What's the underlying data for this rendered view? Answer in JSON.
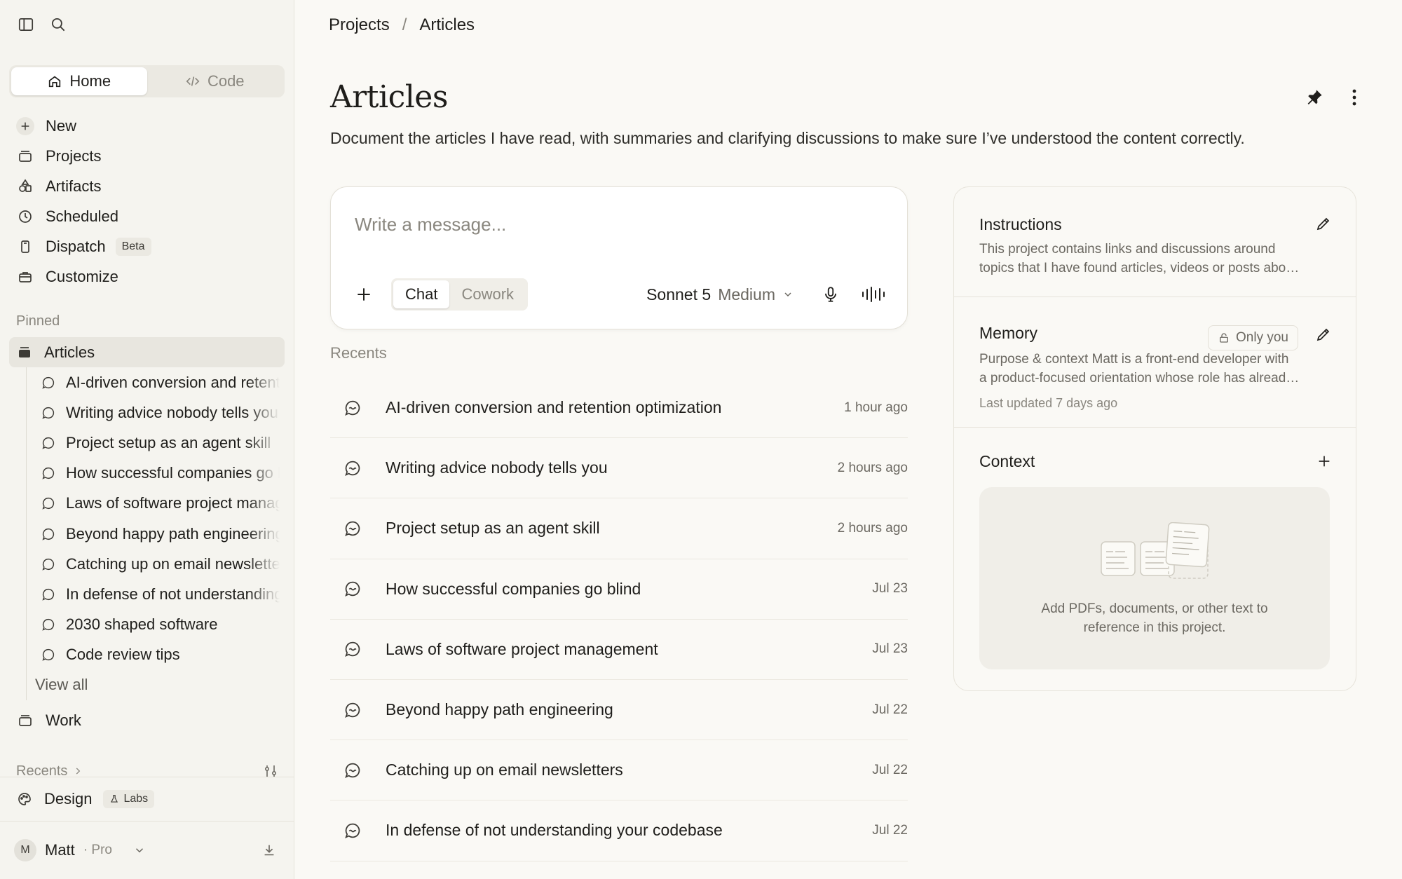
{
  "sidebar": {
    "mode_tabs": [
      {
        "label": "Home",
        "active": true
      },
      {
        "label": "Code",
        "active": false
      }
    ],
    "nav": [
      {
        "label": "New",
        "icon": "plus-icon"
      },
      {
        "label": "Projects",
        "icon": "folder-icon"
      },
      {
        "label": "Artifacts",
        "icon": "shapes-icon"
      },
      {
        "label": "Scheduled",
        "icon": "clock-icon"
      },
      {
        "label": "Dispatch",
        "icon": "phone-icon",
        "badge": "Beta"
      },
      {
        "label": "Customize",
        "icon": "briefcase-icon"
      }
    ],
    "pinned_label": "Pinned",
    "pinned_project": "Articles",
    "pinned_chats": [
      "AI-driven conversion and retention optimization",
      "Writing advice nobody tells you",
      "Project setup as an agent skill",
      "How successful companies go blind",
      "Laws of software project management",
      "Beyond happy path engineering",
      "Catching up on email newsletters",
      "In defense of not understanding your codebase",
      "2030 shaped software",
      "Code review tips"
    ],
    "view_all": "View all",
    "work_label": "Work",
    "recents_label": "Recents",
    "design_label": "Design",
    "labs_badge": "Labs",
    "user": {
      "initial": "M",
      "name": "Matt",
      "plan": "· Pro"
    }
  },
  "breadcrumb": {
    "parent": "Projects",
    "separator": "/",
    "current": "Articles"
  },
  "page": {
    "title": "Articles",
    "description": "Document the articles I have read, with summaries and clarifying discussions to make sure I’ve understood the content correctly."
  },
  "composer": {
    "placeholder": "Write a message...",
    "modes": [
      {
        "label": "Chat",
        "active": true
      },
      {
        "label": "Cowork",
        "active": false
      }
    ],
    "model": "Sonnet 5",
    "effort": "Medium"
  },
  "recents": {
    "label": "Recents",
    "items": [
      {
        "title": "AI-driven conversion and retention optimization",
        "time": "1 hour ago"
      },
      {
        "title": "Writing advice nobody tells you",
        "time": "2 hours ago"
      },
      {
        "title": "Project setup as an agent skill",
        "time": "2 hours ago"
      },
      {
        "title": "How successful companies go blind",
        "time": "Jul 23"
      },
      {
        "title": "Laws of software project management",
        "time": "Jul 23"
      },
      {
        "title": "Beyond happy path engineering",
        "time": "Jul 22"
      },
      {
        "title": "Catching up on email newsletters",
        "time": "Jul 22"
      },
      {
        "title": "In defense of not understanding your codebase",
        "time": "Jul 22"
      }
    ]
  },
  "panel": {
    "instructions": {
      "title": "Instructions",
      "text_line1": "This project contains links and discussions around",
      "text_line2": "topics that I have found articles, videos or posts abo…"
    },
    "memory": {
      "title": "Memory",
      "visibility": "Only you",
      "text_line1": "Purpose & context Matt is a front-end developer with",
      "text_line2": "a product-focused orientation whose role has alread…",
      "updated": "Last updated 7 days ago"
    },
    "context": {
      "title": "Context",
      "empty_line1": "Add PDFs, documents, or other text to",
      "empty_line2": "reference in this project."
    }
  },
  "colors": {
    "background": "#faf9f5",
    "sidebar": "#f5f4ef",
    "text": "#1f1e1b",
    "muted": "#8a877f"
  }
}
